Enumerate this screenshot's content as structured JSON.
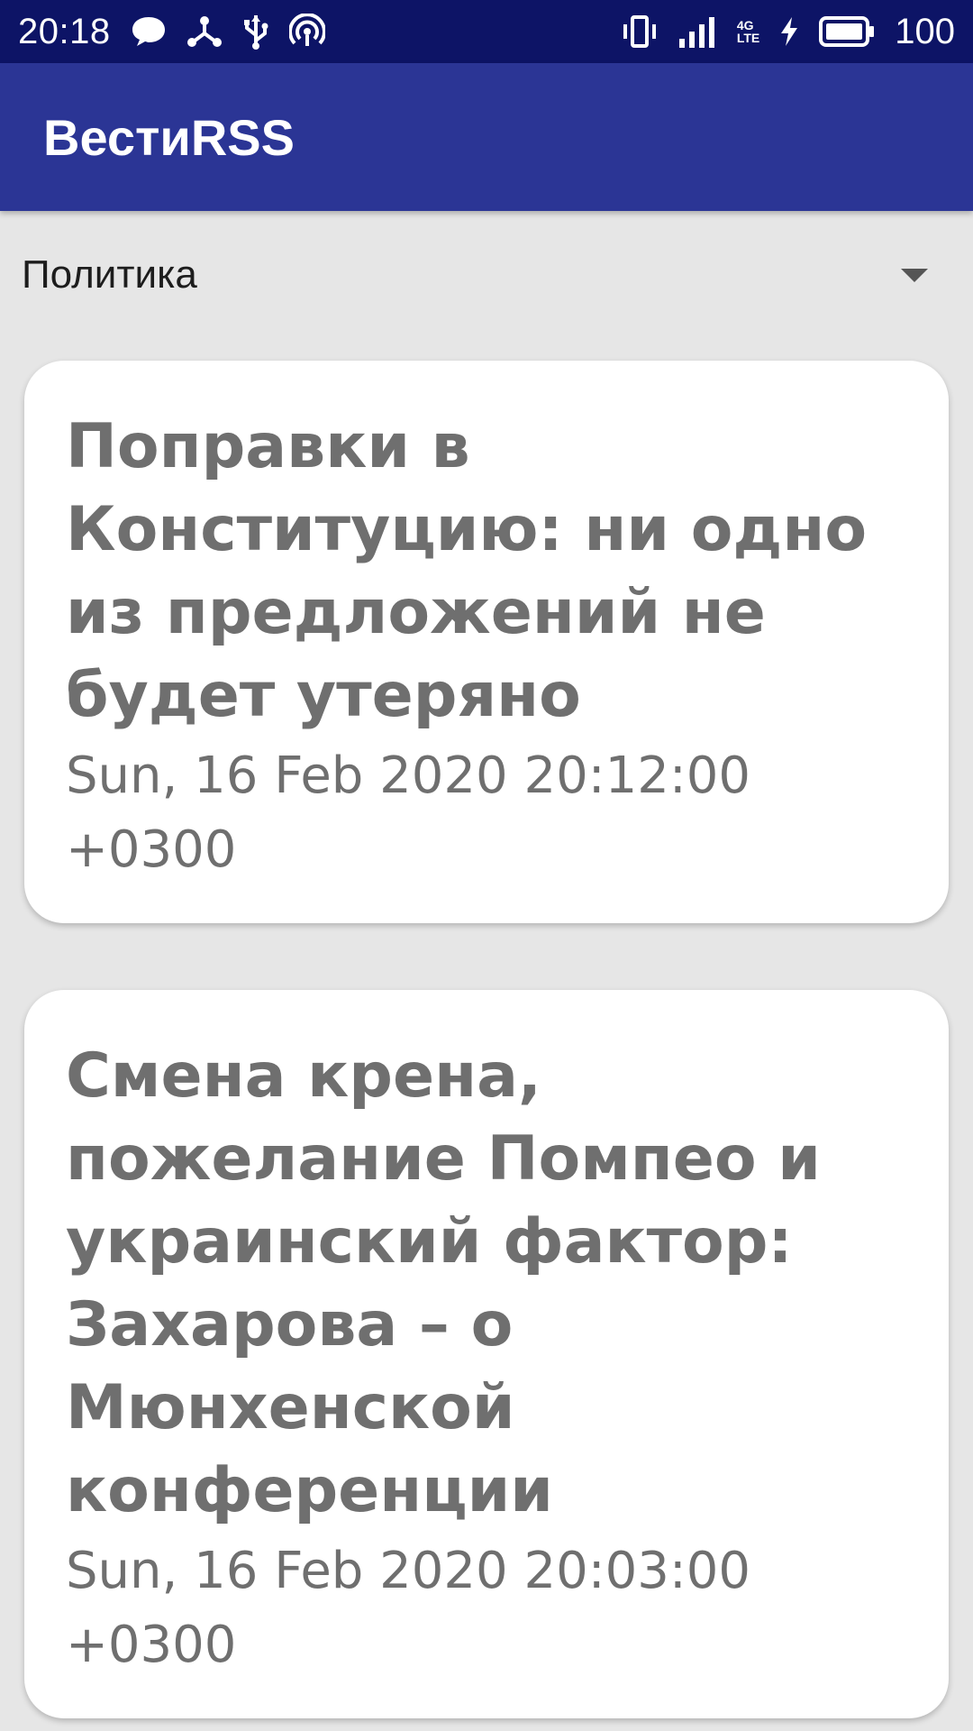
{
  "status_bar": {
    "time": "20:18",
    "battery_level": "100",
    "icons_left": [
      "message-icon",
      "usb-share-icon",
      "usb-icon",
      "hotspot-icon"
    ],
    "icons_right": [
      "vibrate-icon",
      "signal-icon",
      "network-4g-lte-icon",
      "charging-icon",
      "battery-icon"
    ],
    "network_label_top": "4G",
    "network_label_bottom": "LTE"
  },
  "app_bar": {
    "title": "ВестиRSS"
  },
  "category_spinner": {
    "selected": "Политика"
  },
  "articles": [
    {
      "title": "Поправки в Конституцию: ни одно из предложений не будет утеряно",
      "date": "Sun, 16 Feb 2020 20:12:00 +0300"
    },
    {
      "title": "Смена крена, пожелание Помпео и украинский фактор: Захарова – о Мюнхенской конференции",
      "date": "Sun, 16 Feb 2020 20:03:00 +0300"
    }
  ],
  "colors": {
    "status_bar": "#0d1466",
    "app_bar": "#2b3595",
    "background": "#e6e6e6",
    "card_text": "#6f6f6f"
  }
}
